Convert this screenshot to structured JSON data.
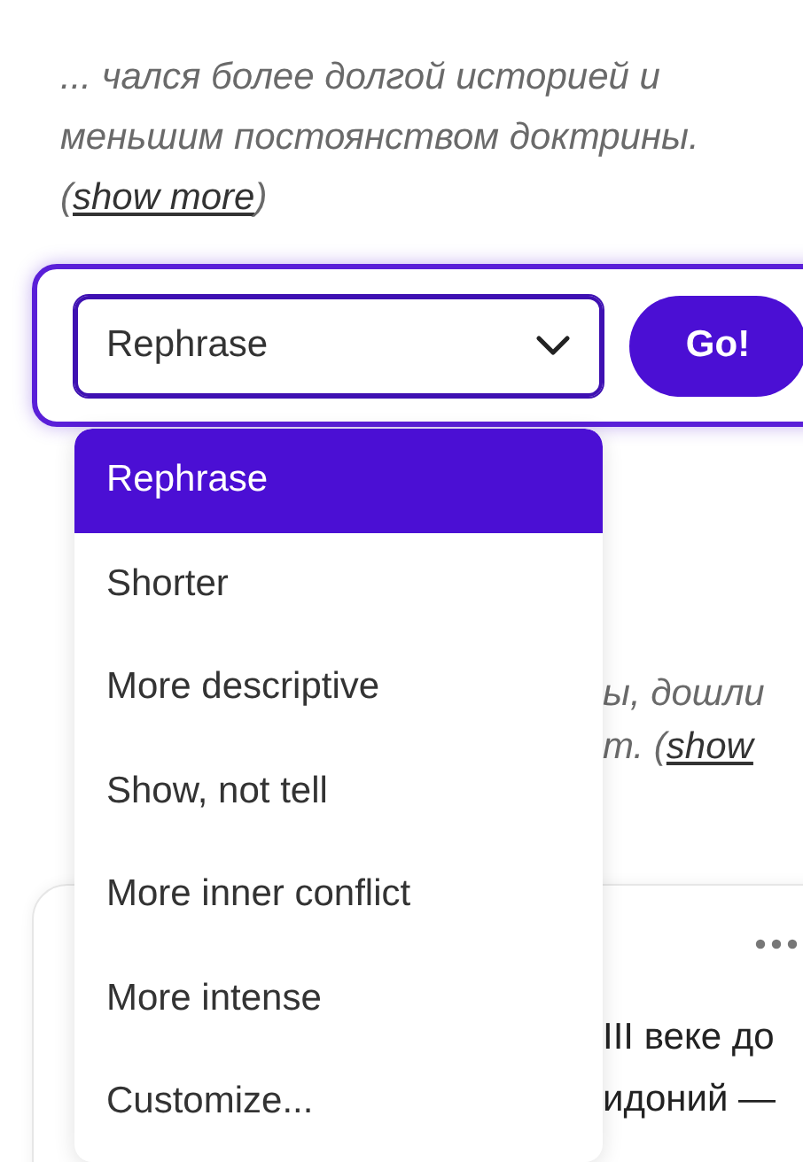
{
  "excerpt": {
    "text": "... чался более долгой историей и меньшим постоянством доктрины.",
    "link_open": "(",
    "link": "show more",
    "link_close": ")"
  },
  "rewrite_panel": {
    "select": {
      "value": "Rephrase",
      "expanded": true
    },
    "go_button": "Go!"
  },
  "dropdown": [
    {
      "label": "Rephrase",
      "selected": true
    },
    {
      "label": "Shorter",
      "selected": false
    },
    {
      "label": "More descriptive",
      "selected": false
    },
    {
      "label": "Show, not tell",
      "selected": false
    },
    {
      "label": "More inner conflict",
      "selected": false
    },
    {
      "label": "More intense",
      "selected": false
    },
    {
      "label": "Customize...",
      "selected": false
    }
  ],
  "next_excerpt": {
    "lines": [
      "ы, дошли",
      "т. ("
    ],
    "link": "show"
  },
  "card": {
    "lines": [
      "III веке до",
      "идоний —"
    ]
  }
}
